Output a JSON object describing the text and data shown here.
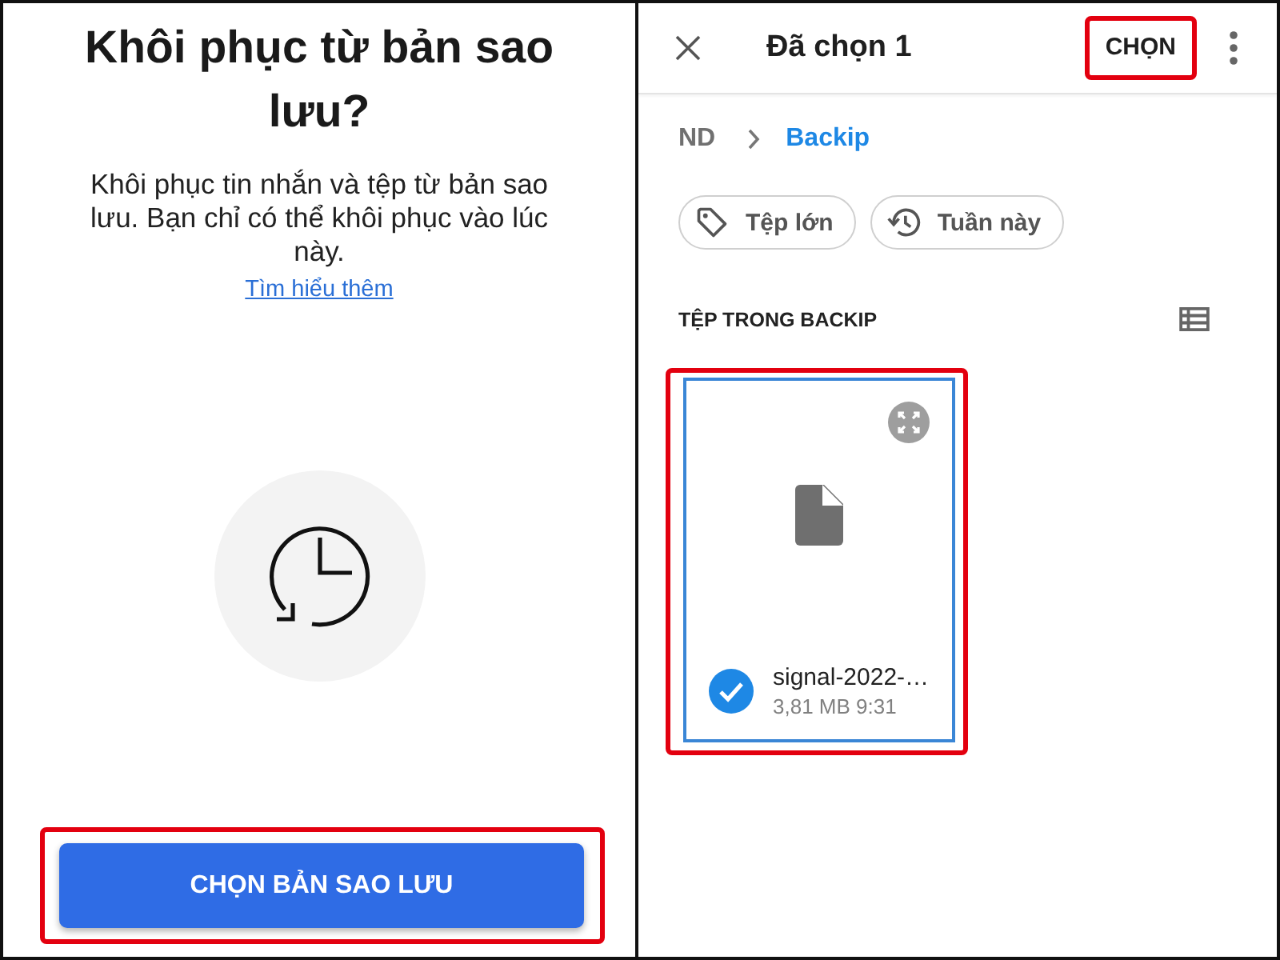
{
  "restore_screen": {
    "title": "Khôi phục từ bản sao lưu?",
    "description": "Khôi phục tin nhắn và tệp từ bản sao lưu. Bạn chỉ có thể khôi phục vào lúc này.",
    "link": "Tìm hiểu thêm",
    "button": {
      "label": "CHỌN BẢN SAO LƯU",
      "highlighted": true
    }
  },
  "file_picker": {
    "title": "Đã chọn 1",
    "action": {
      "label": "CHỌN",
      "highlighted": true
    },
    "breadcrumb": [
      {
        "label": "ND",
        "selected": false
      },
      {
        "label": "Backip",
        "selected": true
      }
    ],
    "chips": [
      {
        "label": "Tệp lớn",
        "kind": "tag"
      },
      {
        "label": "Tuần này",
        "kind": "history"
      }
    ],
    "section_title": "TỆP TRONG BACKIP",
    "files": [
      {
        "name": "signal-2022-…",
        "meta": "3,81 MB 9:31",
        "selected": true,
        "highlighted": true
      }
    ]
  }
}
